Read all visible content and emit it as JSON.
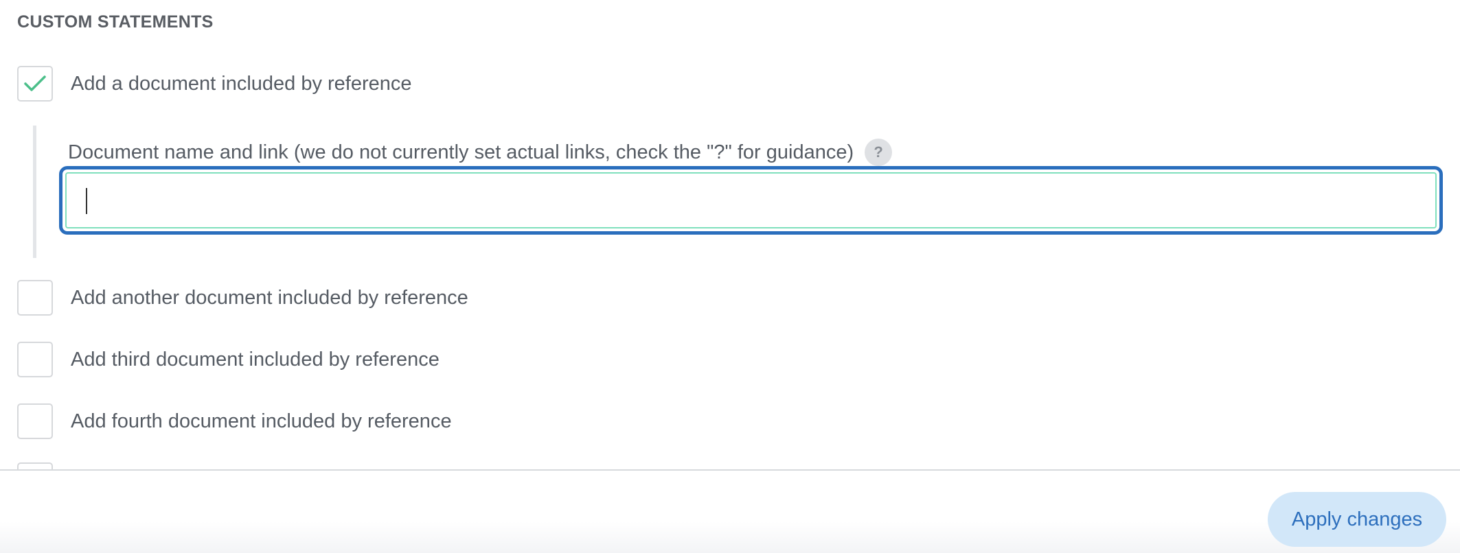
{
  "section": {
    "title": "CUSTOM STATEMENTS"
  },
  "options": [
    {
      "label": "Add a document included by reference",
      "checked": true
    },
    {
      "label": "Add another document included by reference",
      "checked": false
    },
    {
      "label": "Add third document included by reference",
      "checked": false
    },
    {
      "label": "Add fourth document included by reference",
      "checked": false
    }
  ],
  "document_field": {
    "label": "Document name and link (we do not currently set actual links, check the \"?\" for guidance)",
    "help_symbol": "?",
    "value": ""
  },
  "footer": {
    "apply_label": "Apply changes"
  },
  "colors": {
    "accent": "#2a6ebd",
    "check": "#4cbf8a",
    "input_border": "#7fe0bd",
    "button_bg": "#d2e7f9"
  },
  "icons": {
    "checkmark": "checkmark-icon",
    "help": "help-icon"
  }
}
